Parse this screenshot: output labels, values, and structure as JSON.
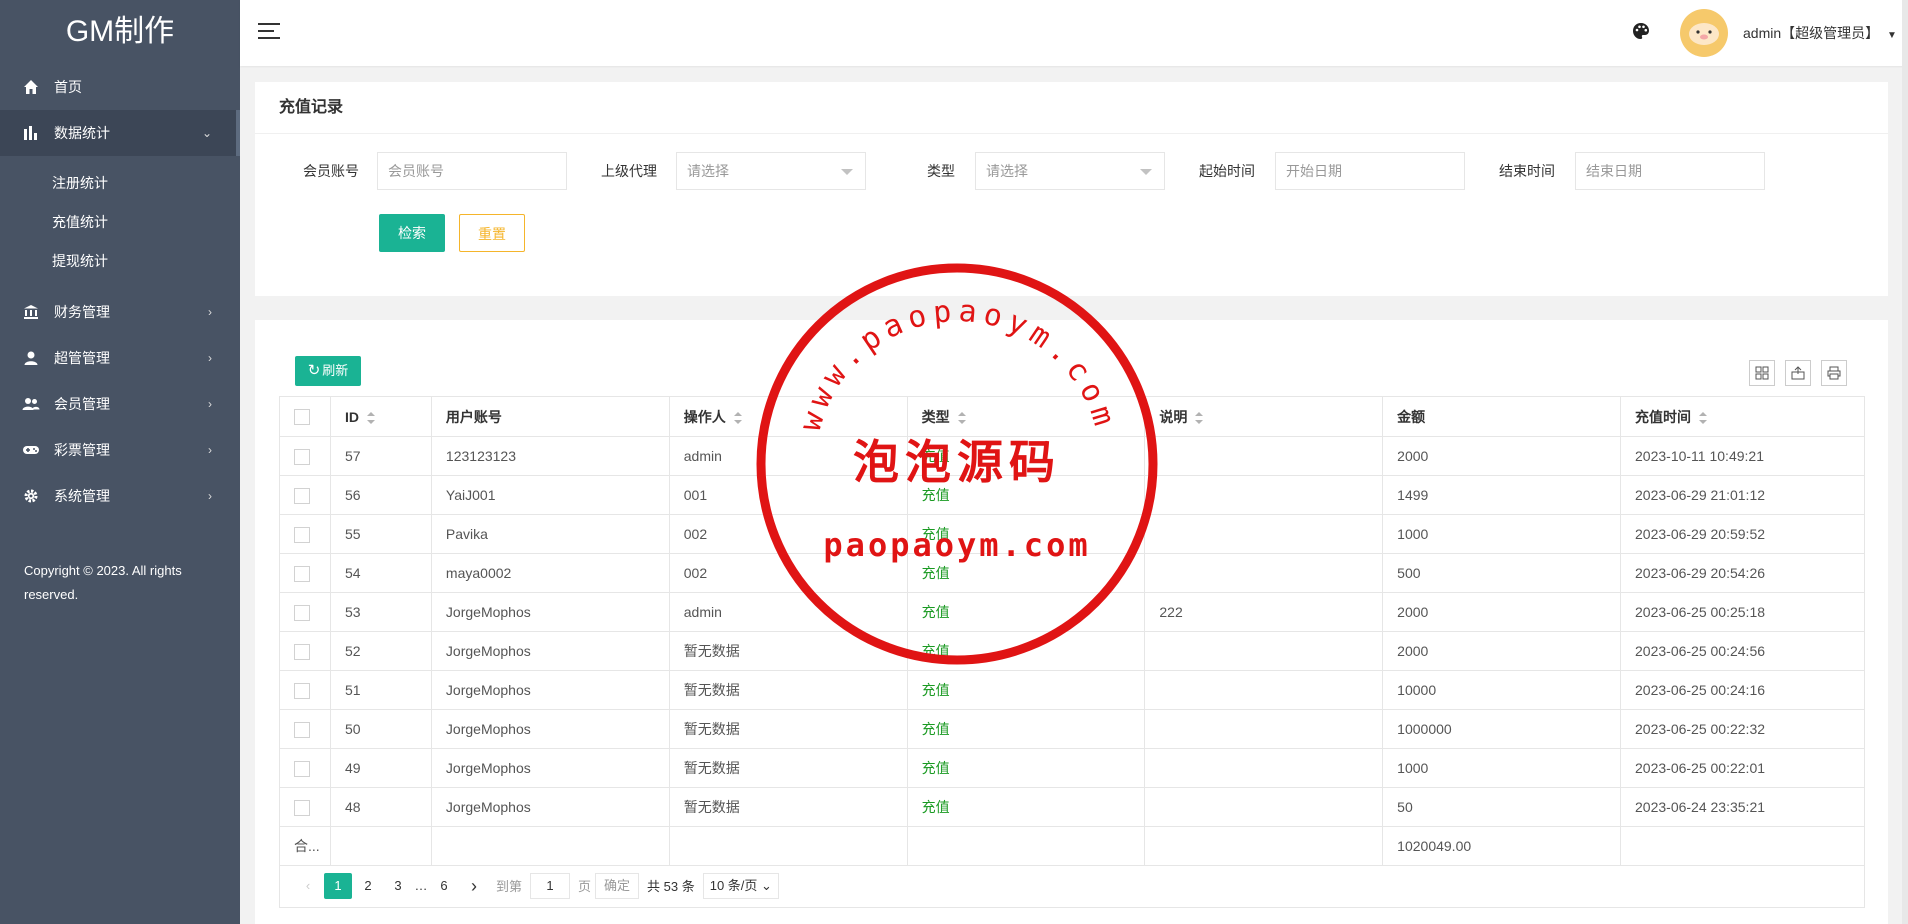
{
  "brand": "GM制作",
  "sidebar": {
    "items": [
      {
        "label": "首页",
        "icon": "home-icon"
      },
      {
        "label": "数据统计",
        "icon": "bar-chart-icon",
        "expanded": true
      },
      {
        "label": "财务管理",
        "icon": "bank-icon"
      },
      {
        "label": "超管管理",
        "icon": "user-icon"
      },
      {
        "label": "会员管理",
        "icon": "users-icon"
      },
      {
        "label": "彩票管理",
        "icon": "gamepad-icon"
      },
      {
        "label": "系统管理",
        "icon": "gear-icon"
      }
    ],
    "submenu": [
      "注册统计",
      "充值统计",
      "提现统计"
    ],
    "copyright": "Copyright © 2023. All rights reserved."
  },
  "header": {
    "user": "admin【超级管理员】",
    "palette_icon": "palette-icon"
  },
  "filter": {
    "title": "充值记录",
    "member_label": "会员账号",
    "member_placeholder": "会员账号",
    "agent_label": "上级代理",
    "agent_placeholder": "请选择",
    "type_label": "类型",
    "type_placeholder": "请选择",
    "start_label": "起始时间",
    "start_placeholder": "开始日期",
    "end_label": "结束时间",
    "end_placeholder": "结束日期",
    "search_label": "检索",
    "reset_label": "重置"
  },
  "table": {
    "refresh_label": "刷新",
    "columns": [
      "ID",
      "用户账号",
      "操作人",
      "类型",
      "说明",
      "金额",
      "充值时间"
    ],
    "rows": [
      {
        "id": "57",
        "account": "123123123",
        "operator": "admin",
        "type": "充值",
        "note": "",
        "amount": "2000",
        "time": "2023-10-11 10:49:21"
      },
      {
        "id": "56",
        "account": "YaiJ001",
        "operator": "001",
        "type": "充值",
        "note": "",
        "amount": "1499",
        "time": "2023-06-29 21:01:12"
      },
      {
        "id": "55",
        "account": "Pavika",
        "operator": "002",
        "type": "充值",
        "note": "",
        "amount": "1000",
        "time": "2023-06-29 20:59:52"
      },
      {
        "id": "54",
        "account": "maya0002",
        "operator": "002",
        "type": "充值",
        "note": "",
        "amount": "500",
        "time": "2023-06-29 20:54:26"
      },
      {
        "id": "53",
        "account": "JorgeMophos",
        "operator": "admin",
        "type": "充值",
        "note": "222",
        "amount": "2000",
        "time": "2023-06-25 00:25:18"
      },
      {
        "id": "52",
        "account": "JorgeMophos",
        "operator": "暂无数据",
        "type": "充值",
        "note": "",
        "amount": "2000",
        "time": "2023-06-25 00:24:56"
      },
      {
        "id": "51",
        "account": "JorgeMophos",
        "operator": "暂无数据",
        "type": "充值",
        "note": "",
        "amount": "10000",
        "time": "2023-06-25 00:24:16"
      },
      {
        "id": "50",
        "account": "JorgeMophos",
        "operator": "暂无数据",
        "type": "充值",
        "note": "",
        "amount": "1000000",
        "time": "2023-06-25 00:22:32"
      },
      {
        "id": "49",
        "account": "JorgeMophos",
        "operator": "暂无数据",
        "type": "充值",
        "note": "",
        "amount": "1000",
        "time": "2023-06-25 00:22:01"
      },
      {
        "id": "48",
        "account": "JorgeMophos",
        "operator": "暂无数据",
        "type": "充值",
        "note": "",
        "amount": "50",
        "time": "2023-06-24 23:35:21"
      }
    ],
    "total_label": "合...",
    "total_amount": "1020049.00"
  },
  "pager": {
    "prev": "‹",
    "pages": [
      "1",
      "2",
      "3",
      "…",
      "6"
    ],
    "next": "›",
    "goto_label": "到第",
    "goto_value": "1",
    "page_unit": "页",
    "ok_label": "确定",
    "total": "共 53 条",
    "page_size": "10 条/页"
  },
  "watermark": {
    "top_text": "www.paopaoym.com",
    "center_text": "泡泡源码",
    "bottom_text": "paopaoym.com",
    "color": "#e01414"
  }
}
